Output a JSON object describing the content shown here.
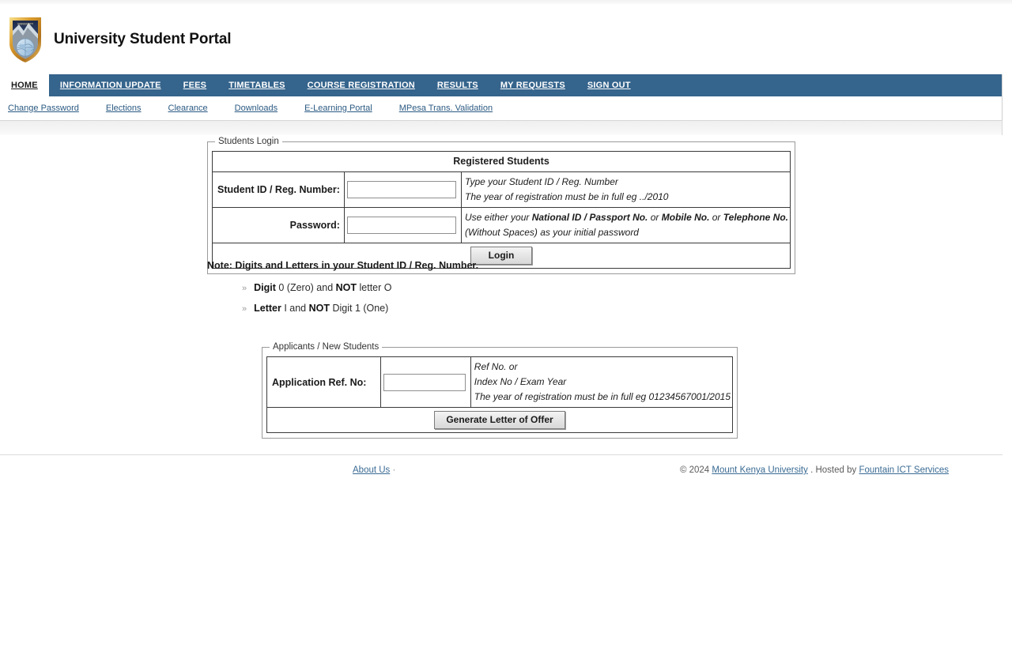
{
  "header": {
    "logo_icon": "university-shield-logo",
    "title": "University Student Portal"
  },
  "nav_primary": {
    "items": [
      {
        "label": "HOME",
        "active": true
      },
      {
        "label": "INFORMATION UPDATE",
        "active": false
      },
      {
        "label": "FEES",
        "active": false
      },
      {
        "label": "TIMETABLES",
        "active": false
      },
      {
        "label": "COURSE REGISTRATION",
        "active": false
      },
      {
        "label": "RESULTS",
        "active": false
      },
      {
        "label": "MY REQUESTS",
        "active": false
      },
      {
        "label": "SIGN OUT",
        "active": false
      }
    ]
  },
  "nav_secondary": {
    "items": [
      {
        "label": "Change Password"
      },
      {
        "label": "Elections"
      },
      {
        "label": "Clearance"
      },
      {
        "label": "Downloads"
      },
      {
        "label": "E-Learning Portal"
      },
      {
        "label": "MPesa Trans. Validation"
      }
    ]
  },
  "students_login": {
    "legend": "Students Login",
    "table_header": "Registered Students",
    "student_id": {
      "label": "Student ID / Reg. Number:",
      "value": "",
      "placeholder": "",
      "hint_line1": "Type your Student ID / Reg. Number",
      "hint_line2": "The year of registration must be in full eg ../2010"
    },
    "password": {
      "label": "Password:",
      "value": "",
      "placeholder": "",
      "hint_line1_pre": "Use either your ",
      "hint_line1_b1": "National ID / Passport No.",
      "hint_line1_mid1": " or ",
      "hint_line1_b2": "Mobile No.",
      "hint_line1_mid2": " or ",
      "hint_line1_b3": "Telephone No.",
      "hint_line2": "(Without Spaces) as your initial password"
    },
    "login_button": "Login"
  },
  "note": {
    "title": "Note: Digits and Letters in your Student ID / Reg. Number.",
    "bullet_glyph": "»",
    "items": [
      {
        "bold1": "Digit",
        "text1": " 0 (Zero) and ",
        "bold2": "NOT",
        "text2": " letter O"
      },
      {
        "bold1": "Letter",
        "text1": " I and ",
        "bold2": "NOT",
        "text2": " Digit 1 (One)"
      }
    ]
  },
  "applicants": {
    "legend": "Applicants / New Students",
    "ref_no": {
      "label": "Application Ref. No:",
      "value": "",
      "placeholder": "",
      "hint_line1": "Ref No. or",
      "hint_line2": "Index No / Exam Year",
      "hint_line3": "The year of registration must be in full eg 01234567001/2015"
    },
    "generate_button": "Generate Letter of Offer"
  },
  "footer": {
    "about_us": "About Us",
    "separator": "·",
    "copyright_mark": "© 2024",
    "university": "Mount Kenya University",
    "hosted_by_text": ". Hosted by",
    "host": "Fountain ICT Services"
  },
  "colors": {
    "nav_blue": "#35648c",
    "link_blue": "#2b5a82",
    "page_bg": "#ffffff"
  }
}
